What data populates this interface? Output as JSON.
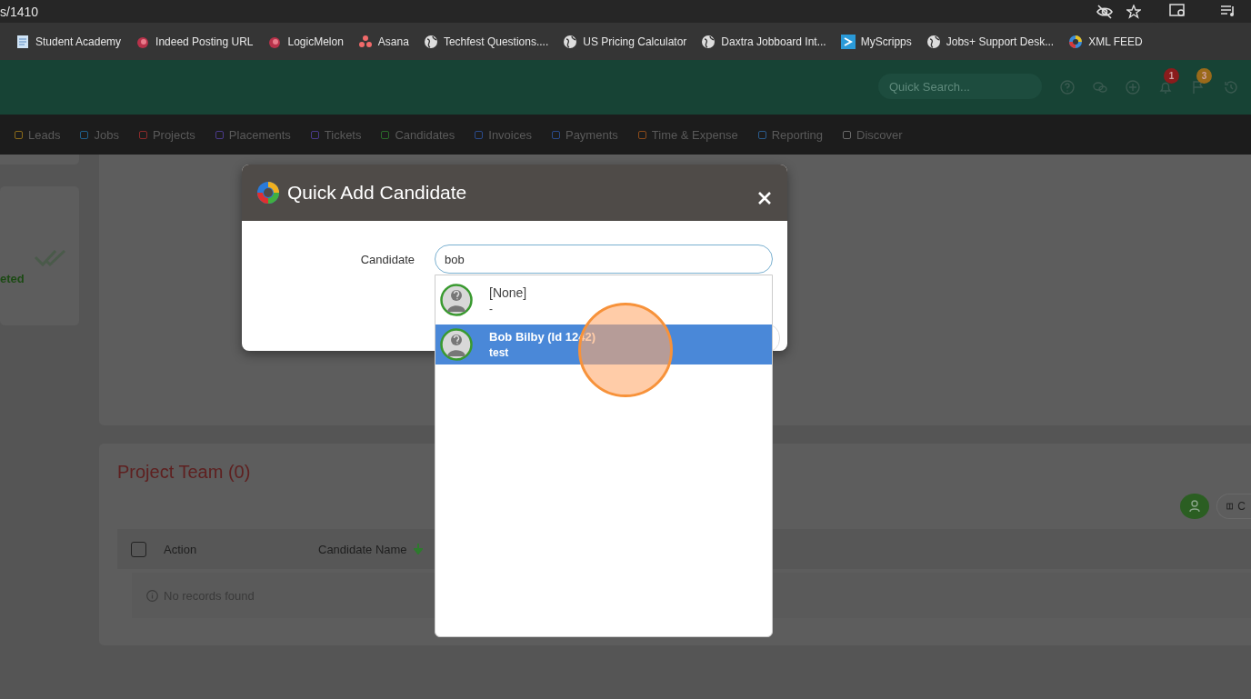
{
  "browser": {
    "url": "s/1410",
    "bookmarks": [
      {
        "label": "Student Academy",
        "kind": "doc"
      },
      {
        "label": "Indeed Posting URL",
        "kind": "melon"
      },
      {
        "label": "LogicMelon",
        "kind": "melon"
      },
      {
        "label": "Asana",
        "kind": "asana"
      },
      {
        "label": "Techfest Questions....",
        "kind": "globe"
      },
      {
        "label": "US Pricing Calculator",
        "kind": "globe"
      },
      {
        "label": "Daxtra Jobboard Int...",
        "kind": "globe"
      },
      {
        "label": "MyScripps",
        "kind": "scripps"
      },
      {
        "label": "Jobs+ Support Desk...",
        "kind": "globe"
      },
      {
        "label": "XML FEED",
        "kind": "feed"
      }
    ]
  },
  "header": {
    "search": {
      "placeholder": "Quick Search..."
    },
    "icons": [
      {
        "kind": "help"
      },
      {
        "kind": "chat"
      },
      {
        "kind": "add"
      },
      {
        "kind": "bell",
        "badge": "1",
        "color": "#8a1c1c"
      },
      {
        "kind": "flag",
        "badge": "3",
        "color": "#9a6a1a"
      },
      {
        "kind": "history"
      }
    ]
  },
  "nav": [
    {
      "label": "Leads",
      "color": "#8a6a1a"
    },
    {
      "label": "Jobs",
      "color": "#1f5f8a"
    },
    {
      "label": "Projects",
      "color": "#8a2a2a"
    },
    {
      "label": "Placements",
      "color": "#4a3a8a"
    },
    {
      "label": "Tickets",
      "color": "#4a3a8a"
    },
    {
      "label": "Candidates",
      "color": "#2a6a2a"
    },
    {
      "label": "Invoices",
      "color": "#2a4a8a"
    },
    {
      "label": "Payments",
      "color": "#2a4a8a"
    },
    {
      "label": "Time & Expense",
      "color": "#8a4a1a"
    },
    {
      "label": "Reporting",
      "color": "#2a5a8a"
    },
    {
      "label": "Discover",
      "color": "#6a6a6a"
    }
  ],
  "status_card": {
    "label": "eted"
  },
  "project_team": {
    "title": "Project Team (0)",
    "toolbar_button": "C",
    "select_all_checked": false,
    "columns": [
      "Action",
      "Candidate Name"
    ],
    "empty_message": "No records found"
  },
  "modal": {
    "title": "Quick Add Candidate",
    "field_label": "Candidate",
    "value": "bob",
    "options": [
      {
        "title": "[None]",
        "subtitle": "-",
        "selected": false
      },
      {
        "title": "Bob Bilby (Id 1242)",
        "subtitle": "test",
        "selected": true
      }
    ]
  }
}
